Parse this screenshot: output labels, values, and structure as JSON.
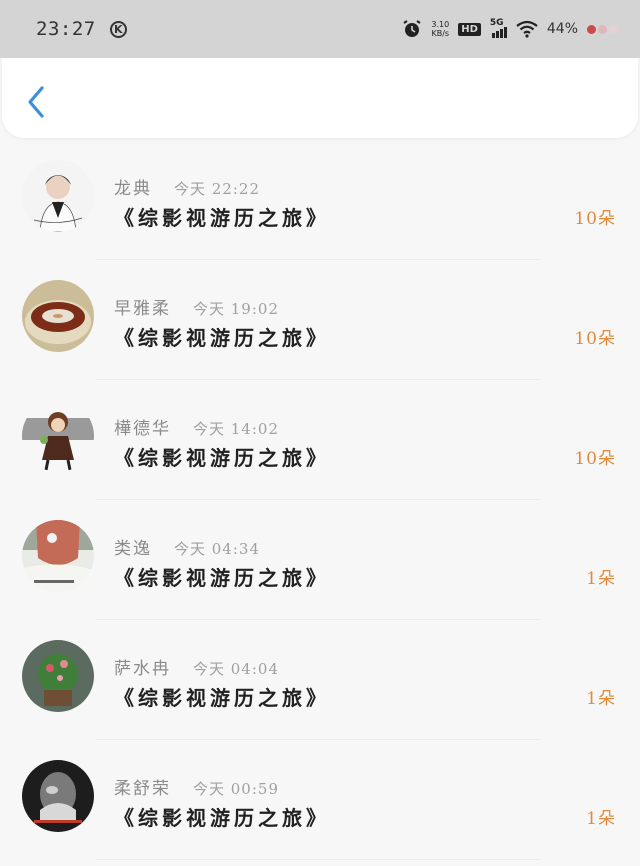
{
  "status_bar": {
    "time": "23:27",
    "k_badge": "K",
    "net_speed_value": "3.10",
    "net_speed_unit": "KB/s",
    "hd_label": "HD",
    "network_label": "5G",
    "battery": "44%",
    "icons": [
      "alarm-icon",
      "wifi-icon",
      "signal-icon"
    ]
  },
  "header": {
    "back_icon": "chevron-left-icon",
    "accent": "#3d8fdc"
  },
  "gifts": [
    {
      "name": "龙典",
      "time": "今天 22:22",
      "title": "《综影视游历之旅》",
      "count": "10朵"
    },
    {
      "name": "早雅柔",
      "time": "今天 19:02",
      "title": "《综影视游历之旅》",
      "count": "10朵"
    },
    {
      "name": "樺德华",
      "time": "今天 14:02",
      "title": "《综影视游历之旅》",
      "count": "10朵"
    },
    {
      "name": "类逸",
      "time": "今天 04:34",
      "title": "《综影视游历之旅》",
      "count": "1朵"
    },
    {
      "name": "萨水冉",
      "time": "今天 04:04",
      "title": "《综影视游历之旅》",
      "count": "1朵"
    },
    {
      "name": "柔舒荣",
      "time": "今天 00:59",
      "title": "《综影视游历之旅》",
      "count": "1朵"
    }
  ],
  "colors": {
    "count": "#e08a3c",
    "name": "#8b8b8b",
    "status_bar_bg": "#d4d4d4"
  }
}
